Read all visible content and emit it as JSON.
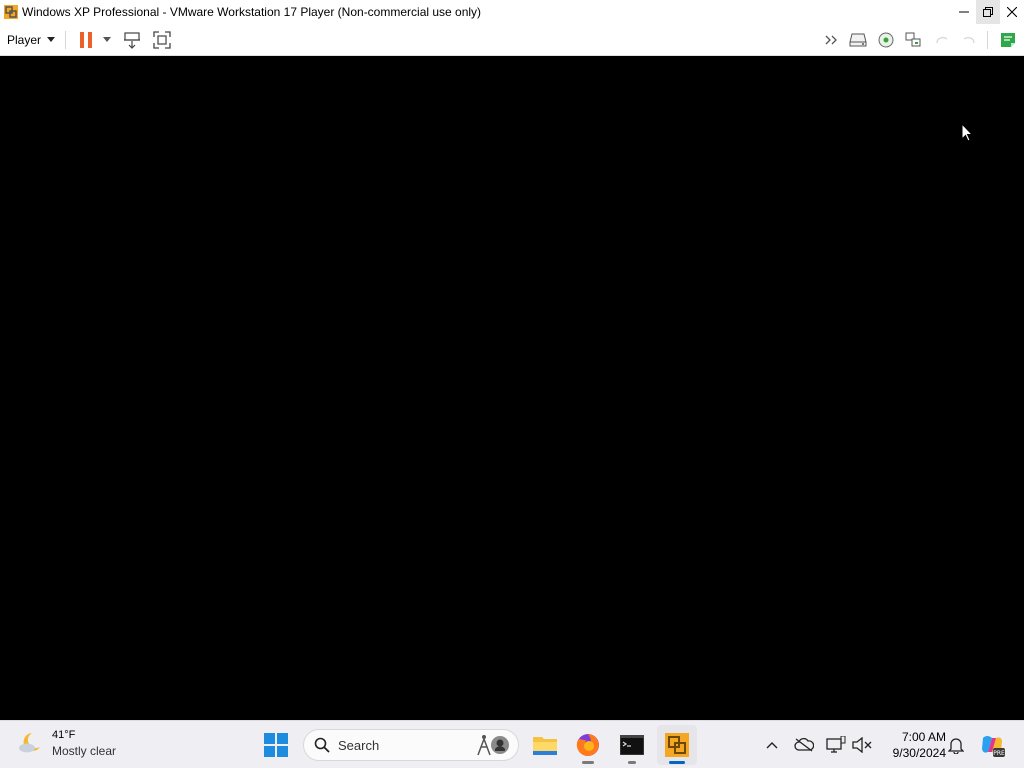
{
  "window": {
    "title": "Windows XP Professional - VMware Workstation 17 Player (Non-commercial use only)",
    "controls": [
      "minimize",
      "restore",
      "close"
    ]
  },
  "toolbar": {
    "player_menu_label": "Player",
    "left_icons": [
      "pause-icon",
      "dropdown-arrow-icon",
      "send-ctrl-alt-del-icon",
      "full-screen-icon"
    ],
    "right_icons": [
      "more-devices-icon",
      "hard-disk-icon",
      "cd-dvd-icon",
      "network-adapter-icon",
      "unity-disabled-icon",
      "unity-exit-disabled-icon",
      "message-log-icon"
    ]
  },
  "vm_screen": {
    "background": "#000000"
  },
  "taskbar": {
    "weather": {
      "temperature": "41°F",
      "condition": "Mostly clear"
    },
    "search": {
      "placeholder": "Search"
    },
    "apps": [
      "windows-start",
      "search",
      "file-explorer",
      "firefox",
      "command-prompt",
      "vmware-player"
    ],
    "tray_icons": [
      "show-hidden-icons",
      "network-disconnected-icon",
      "display-icon",
      "speaker-muted-icon",
      "notifications-bell-icon",
      "copilot-icon"
    ],
    "clock": {
      "time": "7:00 AM",
      "date": "9/30/2024"
    }
  },
  "colors": {
    "accent": "#0067c0",
    "pause": "#e8632a",
    "vmware_orange": "#f5a623"
  }
}
